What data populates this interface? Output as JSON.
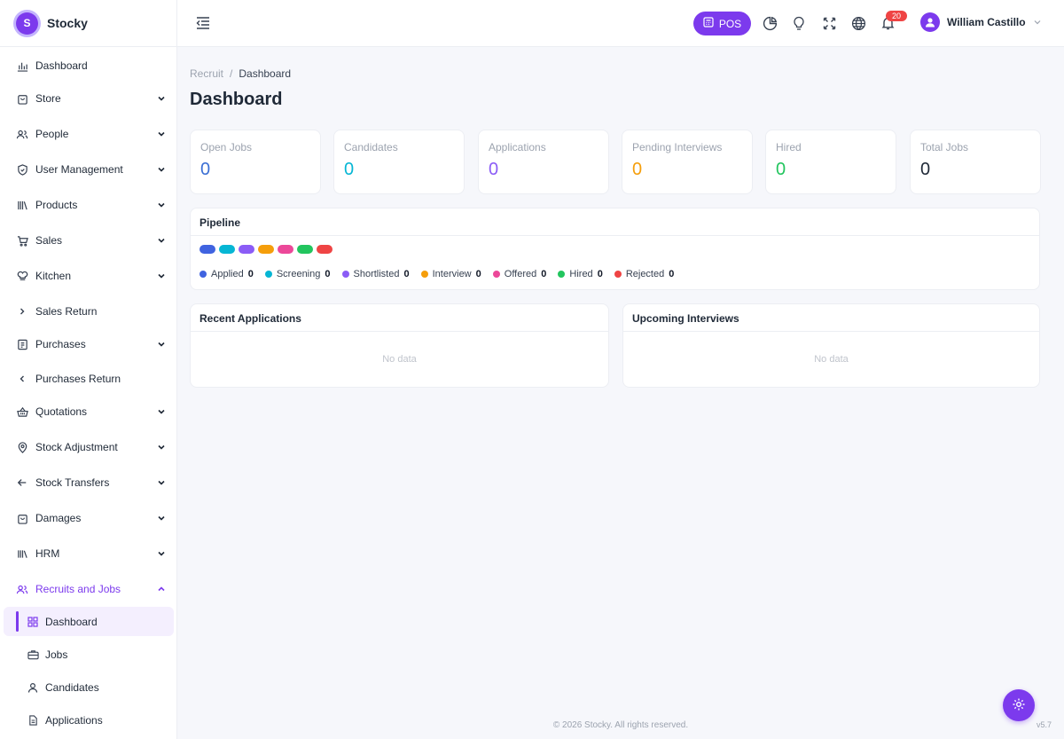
{
  "brand": {
    "name": "Stocky",
    "logo_letter": "S",
    "accent": "#7c3aed"
  },
  "sidebar": {
    "items": [
      {
        "label": "Dashboard",
        "icon": "bar-chart-icon",
        "caret": "none"
      },
      {
        "label": "Store",
        "icon": "store-bag-icon",
        "caret": "down"
      },
      {
        "label": "People",
        "icon": "users-icon",
        "caret": "down"
      },
      {
        "label": "User Management",
        "icon": "shield-icon",
        "caret": "down"
      },
      {
        "label": "Products",
        "icon": "books-icon",
        "caret": "down"
      },
      {
        "label": "Sales",
        "icon": "cart-icon",
        "caret": "down"
      },
      {
        "label": "Kitchen",
        "icon": "chef-hat-icon",
        "caret": "down"
      },
      {
        "label": "Sales Return",
        "icon": "chevron-right-icon",
        "caret": "none"
      },
      {
        "label": "Purchases",
        "icon": "receipt-icon",
        "caret": "down"
      },
      {
        "label": "Purchases Return",
        "icon": "chevron-left-icon",
        "caret": "none"
      },
      {
        "label": "Quotations",
        "icon": "basket-icon",
        "caret": "down"
      },
      {
        "label": "Stock Adjustment",
        "icon": "location-pin-icon",
        "caret": "down"
      },
      {
        "label": "Stock Transfers",
        "icon": "arrow-left-icon",
        "caret": "down"
      },
      {
        "label": "Damages",
        "icon": "bag-icon",
        "caret": "down"
      },
      {
        "label": "HRM",
        "icon": "library-icon",
        "caret": "down"
      },
      {
        "label": "Recruits and Jobs",
        "icon": "users-icon",
        "caret": "up"
      }
    ],
    "sub_items": [
      {
        "label": "Dashboard",
        "icon": "grid-icon"
      },
      {
        "label": "Jobs",
        "icon": "briefcase-icon"
      },
      {
        "label": "Candidates",
        "icon": "user-icon"
      },
      {
        "label": "Applications",
        "icon": "document-icon"
      }
    ]
  },
  "topbar": {
    "pos_label": "POS",
    "notification_count": "20",
    "user_name": "William Castillo"
  },
  "breadcrumb": {
    "parent": "Recruit",
    "separator": "/",
    "current": "Dashboard"
  },
  "page_title": "Dashboard",
  "stats": [
    {
      "label": "Open Jobs",
      "value": "0",
      "color": "#3b6fd4"
    },
    {
      "label": "Candidates",
      "value": "0",
      "color": "#06b6d4"
    },
    {
      "label": "Applications",
      "value": "0",
      "color": "#8b5cf6"
    },
    {
      "label": "Pending Interviews",
      "value": "0",
      "color": "#f59e0b"
    },
    {
      "label": "Hired",
      "value": "0",
      "color": "#22c55e"
    },
    {
      "label": "Total Jobs",
      "value": "0",
      "color": "#1f2937"
    }
  ],
  "pipeline": {
    "title": "Pipeline",
    "stages": [
      {
        "label": "Applied",
        "count": "0",
        "color": "#4063e0"
      },
      {
        "label": "Screening",
        "count": "0",
        "color": "#06b6d4"
      },
      {
        "label": "Shortlisted",
        "count": "0",
        "color": "#8b5cf6"
      },
      {
        "label": "Interview",
        "count": "0",
        "color": "#f59e0b"
      },
      {
        "label": "Offered",
        "count": "0",
        "color": "#ec4899"
      },
      {
        "label": "Hired",
        "count": "0",
        "color": "#22c55e"
      },
      {
        "label": "Rejected",
        "count": "0",
        "color": "#ef4444"
      }
    ]
  },
  "recent_applications": {
    "title": "Recent Applications",
    "empty": "No data"
  },
  "upcoming_interviews": {
    "title": "Upcoming Interviews",
    "empty": "No data"
  },
  "footer": {
    "copyright": "© 2026 Stocky. All rights reserved.",
    "version": "v5.7"
  }
}
